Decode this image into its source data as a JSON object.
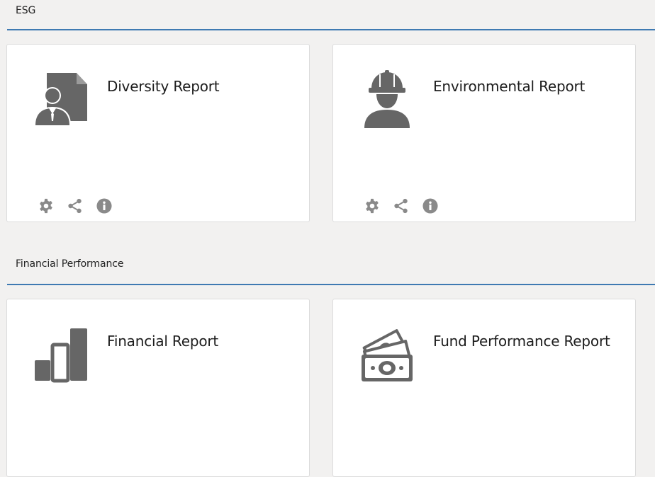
{
  "sections": [
    {
      "title": "ESG",
      "cards": [
        {
          "title": "Diversity Report",
          "icon": "diversity-report-icon",
          "show_actions": true
        },
        {
          "title": "Environmental Report",
          "icon": "worker-hardhat-icon",
          "show_actions": true
        }
      ]
    },
    {
      "title": "Financial Performance",
      "cards": [
        {
          "title": "Financial Report",
          "icon": "bar-chart-icon",
          "show_actions": false
        },
        {
          "title": "Fund Performance Report",
          "icon": "money-bills-icon",
          "show_actions": false
        }
      ]
    }
  ],
  "actions": {
    "settings_icon": "gear-icon",
    "share_icon": "share-icon",
    "info_icon": "info-icon"
  },
  "colors": {
    "accent_line": "#3f7ab2",
    "icon_gray": "#666666",
    "action_gray": "#8a8a8a",
    "background": "#f2f1f0"
  }
}
